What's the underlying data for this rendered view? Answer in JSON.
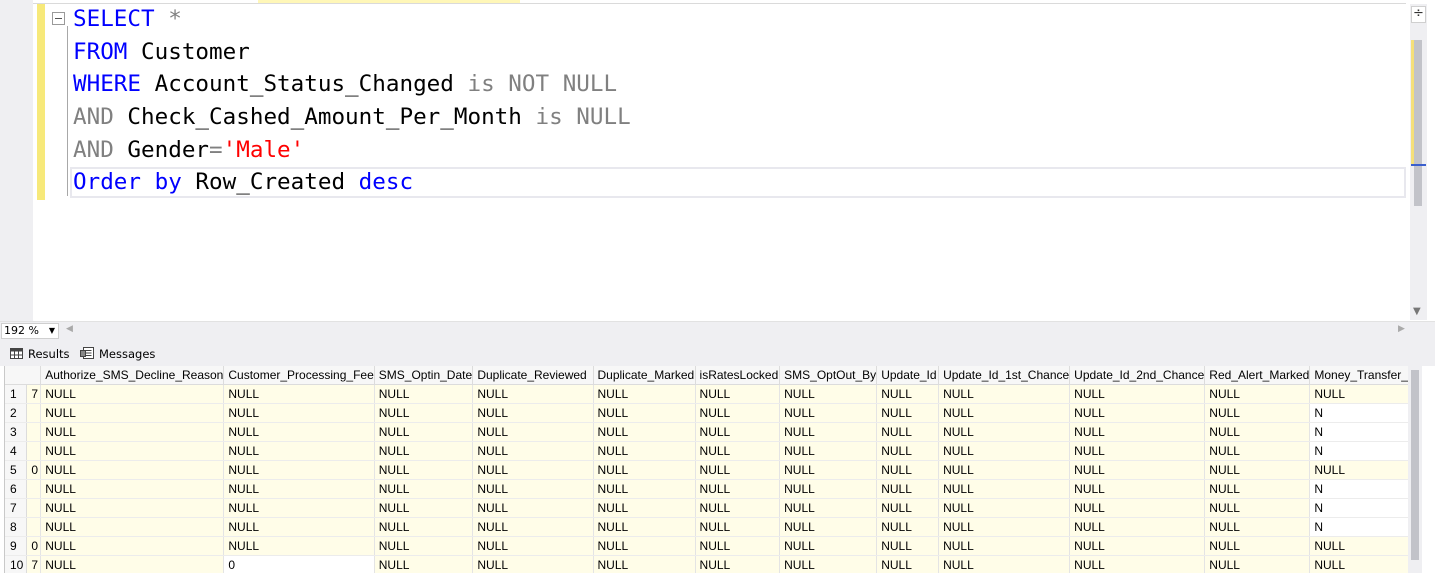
{
  "editor": {
    "lines": [
      [
        {
          "t": "SELECT",
          "c": "kw"
        },
        {
          "t": " ",
          "c": "id"
        },
        {
          "t": "*",
          "c": "op"
        }
      ],
      [
        {
          "t": "FROM",
          "c": "kw"
        },
        {
          "t": " Customer",
          "c": "id"
        }
      ],
      [
        {
          "t": "WHERE",
          "c": "kw"
        },
        {
          "t": " Account_Status_Changed ",
          "c": "id"
        },
        {
          "t": "is NOT NULL",
          "c": "op"
        }
      ],
      [
        {
          "t": "AND",
          "c": "op"
        },
        {
          "t": " Check_Cashed_Amount_Per_Month ",
          "c": "id"
        },
        {
          "t": "is NULL",
          "c": "op"
        }
      ],
      [
        {
          "t": "AND",
          "c": "op"
        },
        {
          "t": " Gender",
          "c": "id"
        },
        {
          "t": "=",
          "c": "op"
        },
        {
          "t": "'Male'",
          "c": "str"
        }
      ],
      [
        {
          "t": "Order by",
          "c": "kw"
        },
        {
          "t": " Row_Created ",
          "c": "id"
        },
        {
          "t": "desc",
          "c": "kw"
        }
      ]
    ],
    "split_button": "÷"
  },
  "zoom": {
    "value": "192 %"
  },
  "result_tabs": {
    "results": "Results",
    "messages": "Messages"
  },
  "grid": {
    "columns": [
      "",
      "Authorize_SMS_Decline_Reason",
      "Customer_Processing_Fee",
      "SMS_Optin_Date",
      "Duplicate_Reviewed",
      "Duplicate_Marked",
      "isRatesLocked",
      "SMS_OptOut_By",
      "Update_Id",
      "Update_Id_1st_Chance",
      "Update_Id_2nd_Chance",
      "Red_Alert_Marked",
      "Money_Transfer_"
    ],
    "rows": [
      {
        "n": "1",
        "edge": "7",
        "cells": [
          "NULL",
          "NULL",
          "NULL",
          "NULL",
          "NULL",
          "NULL",
          "NULL",
          "NULL",
          "NULL",
          "NULL",
          "NULL",
          "NULL"
        ]
      },
      {
        "n": "2",
        "edge": "",
        "cells": [
          "NULL",
          "NULL",
          "NULL",
          "NULL",
          "NULL",
          "NULL",
          "NULL",
          "NULL",
          "NULL",
          "NULL",
          "NULL",
          "N"
        ]
      },
      {
        "n": "3",
        "edge": "",
        "cells": [
          "NULL",
          "NULL",
          "NULL",
          "NULL",
          "NULL",
          "NULL",
          "NULL",
          "NULL",
          "NULL",
          "NULL",
          "NULL",
          "N"
        ]
      },
      {
        "n": "4",
        "edge": "",
        "cells": [
          "NULL",
          "NULL",
          "NULL",
          "NULL",
          "NULL",
          "NULL",
          "NULL",
          "NULL",
          "NULL",
          "NULL",
          "NULL",
          "N"
        ]
      },
      {
        "n": "5",
        "edge": "0",
        "cells": [
          "NULL",
          "NULL",
          "NULL",
          "NULL",
          "NULL",
          "NULL",
          "NULL",
          "NULL",
          "NULL",
          "NULL",
          "NULL",
          "NULL"
        ]
      },
      {
        "n": "6",
        "edge": "",
        "cells": [
          "NULL",
          "NULL",
          "NULL",
          "NULL",
          "NULL",
          "NULL",
          "NULL",
          "NULL",
          "NULL",
          "NULL",
          "NULL",
          "N"
        ]
      },
      {
        "n": "7",
        "edge": "",
        "cells": [
          "NULL",
          "NULL",
          "NULL",
          "NULL",
          "NULL",
          "NULL",
          "NULL",
          "NULL",
          "NULL",
          "NULL",
          "NULL",
          "N"
        ]
      },
      {
        "n": "8",
        "edge": "",
        "cells": [
          "NULL",
          "NULL",
          "NULL",
          "NULL",
          "NULL",
          "NULL",
          "NULL",
          "NULL",
          "NULL",
          "NULL",
          "NULL",
          "N"
        ]
      },
      {
        "n": "9",
        "edge": "0",
        "cells": [
          "NULL",
          "NULL",
          "NULL",
          "NULL",
          "NULL",
          "NULL",
          "NULL",
          "NULL",
          "NULL",
          "NULL",
          "NULL",
          "NULL"
        ]
      },
      {
        "n": "10",
        "edge": "7",
        "cells": [
          "NULL",
          "0",
          "NULL",
          "NULL",
          "NULL",
          "NULL",
          "NULL",
          "NULL",
          "NULL",
          "NULL",
          "NULL",
          "NULL"
        ]
      }
    ]
  }
}
